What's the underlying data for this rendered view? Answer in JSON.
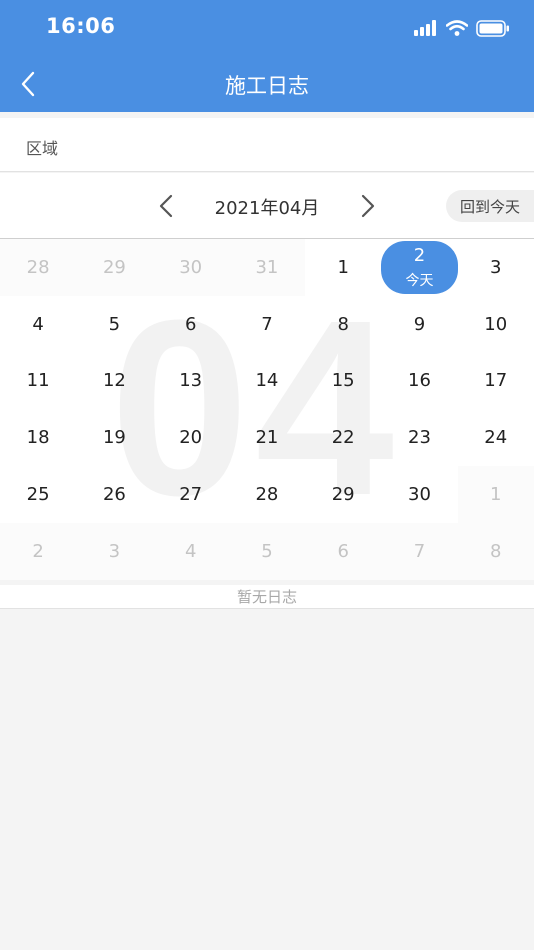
{
  "status_bar": {
    "time": "16:06"
  },
  "nav": {
    "title": "施工日志"
  },
  "region": {
    "label": "区域"
  },
  "month_bar": {
    "month": "2021年04月",
    "today_button": "回到今天"
  },
  "calendar": {
    "watermark": "04",
    "today_label": "今天",
    "days": [
      {
        "n": "28",
        "other": true
      },
      {
        "n": "29",
        "other": true
      },
      {
        "n": "30",
        "other": true
      },
      {
        "n": "31",
        "other": true
      },
      {
        "n": "1"
      },
      {
        "n": "2",
        "today": true
      },
      {
        "n": "3"
      },
      {
        "n": "4"
      },
      {
        "n": "5"
      },
      {
        "n": "6"
      },
      {
        "n": "7"
      },
      {
        "n": "8"
      },
      {
        "n": "9"
      },
      {
        "n": "10"
      },
      {
        "n": "11"
      },
      {
        "n": "12"
      },
      {
        "n": "13"
      },
      {
        "n": "14"
      },
      {
        "n": "15"
      },
      {
        "n": "16"
      },
      {
        "n": "17"
      },
      {
        "n": "18"
      },
      {
        "n": "19"
      },
      {
        "n": "20"
      },
      {
        "n": "21"
      },
      {
        "n": "22"
      },
      {
        "n": "23"
      },
      {
        "n": "24"
      },
      {
        "n": "25"
      },
      {
        "n": "26"
      },
      {
        "n": "27"
      },
      {
        "n": "28"
      },
      {
        "n": "29"
      },
      {
        "n": "30"
      },
      {
        "n": "1",
        "other": true
      },
      {
        "n": "2",
        "other": true
      },
      {
        "n": "3",
        "other": true
      },
      {
        "n": "4",
        "other": true
      },
      {
        "n": "5",
        "other": true
      },
      {
        "n": "6",
        "other": true
      },
      {
        "n": "7",
        "other": true
      },
      {
        "n": "8",
        "other": true
      }
    ]
  },
  "log": {
    "empty_text": "暂无日志"
  },
  "colors": {
    "accent": "#4a8fe2",
    "background": "#f4f4f4"
  },
  "icons": {
    "back": "chevron-left-icon",
    "prev": "chevron-left-icon",
    "next": "chevron-right-icon"
  }
}
